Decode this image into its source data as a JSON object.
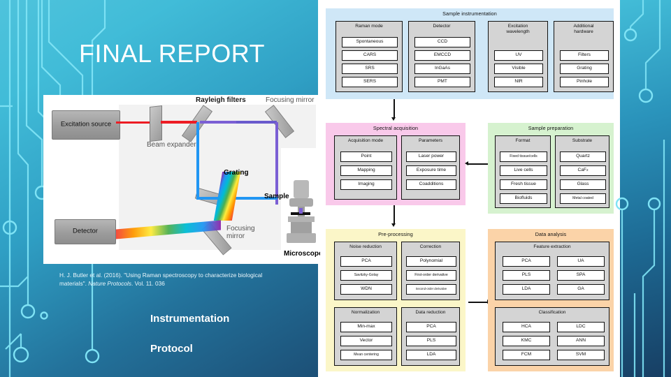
{
  "slide": {
    "title": "FINAL REPORT",
    "citation_part1": "H. J. Butler et al. (2016). \"Using Raman spectroscopy to characterize biological materials\". ",
    "citation_italic": "Nature Protocols",
    "citation_part2": ". Vol. 11. 036",
    "bullets": [
      "Instrumentation",
      "Protocol"
    ],
    "accent_color": "#41bcd8",
    "deep_color": "#1c4f76"
  },
  "schematic": {
    "labels": {
      "excitation_source": "Excitation\nsource",
      "beam_expander": "Beam expander",
      "rayleigh_filters": "Rayleigh filters",
      "focusing_mirror_top": "Focusing mirror",
      "grating": "Grating",
      "detector": "Detector",
      "focusing_mirror_bottom": "Focusing\nmirror",
      "sample": "Sample",
      "microscope": "Microscope"
    }
  },
  "flowchart": {
    "panels": [
      {
        "key": "sample_instrumentation",
        "title": "Sample instrumentation",
        "bg": "#cfe7f7",
        "columns": [
          {
            "title": "Raman mode",
            "items": [
              "Spontaneous",
              "CARS",
              "SRS",
              "SERS"
            ]
          },
          {
            "title": "Detector",
            "items": [
              "CCD",
              "EMCCD",
              "InGaAs",
              "PMT"
            ]
          },
          {
            "title": "Excitation\nwavelength",
            "items": [
              "UV",
              "Visible",
              "NIR"
            ]
          },
          {
            "title": "Additional\nhardware",
            "items": [
              "Filters",
              "Grating",
              "Pinhole"
            ]
          }
        ]
      },
      {
        "key": "spectral_acquisition",
        "title": "Spectral acquisition",
        "bg": "#f9c9ea",
        "columns": [
          {
            "title": "Acquisition mode",
            "items": [
              "Point",
              "Mapping",
              "Imaging"
            ]
          },
          {
            "title": "Parameters",
            "items": [
              "Laser power",
              "Exposure time",
              "Coadditions"
            ]
          }
        ]
      },
      {
        "key": "sample_preparation",
        "title": "Sample preparation",
        "bg": "#d6f2cf",
        "columns": [
          {
            "title": "Format",
            "items": [
              "Fixed tissue/cells",
              "Live cells",
              "Fresh tissue",
              "Biofluids"
            ]
          },
          {
            "title": "Substrate",
            "items": [
              "Quartz",
              "CaF2",
              "Glass",
              "Metal coated"
            ]
          }
        ]
      },
      {
        "key": "pre_processing",
        "title": "Pre-processing",
        "bg": "#fbf6c8",
        "columns": [
          {
            "title": "Noise reduction",
            "items": [
              "PCA",
              "Savitzky-Golay",
              "WDN"
            ]
          },
          {
            "title": "Correction",
            "items": [
              "Polynomial",
              "First-order derivative",
              "Second-order derivative"
            ]
          },
          {
            "title": "Normalization",
            "items": [
              "Min-max",
              "Vector",
              "Mean centering"
            ]
          },
          {
            "title": "Data reduction",
            "items": [
              "PCA",
              "PLS",
              "LDA"
            ]
          }
        ]
      },
      {
        "key": "data_analysis",
        "title": "Data analysis",
        "bg": "#fbd3a8",
        "columns": [
          {
            "title": "Feature extraction",
            "items_left": [
              "PCA",
              "PLS",
              "LDA"
            ],
            "items_right": [
              "UA",
              "SPA",
              "GA"
            ]
          },
          {
            "title": "Classification",
            "items_left": [
              "HCA",
              "KMC",
              "FCM"
            ],
            "items_right": [
              "LDC",
              "ANN",
              "SVM"
            ]
          }
        ]
      }
    ]
  }
}
